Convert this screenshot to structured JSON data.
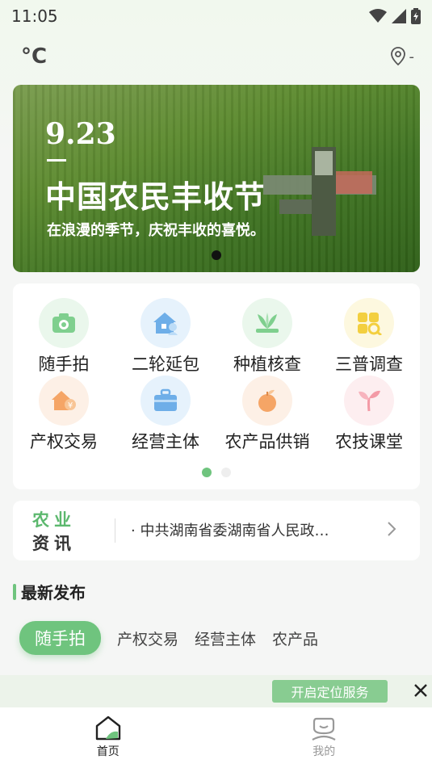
{
  "status": {
    "time": "11:05"
  },
  "header": {
    "temperature": "°C",
    "location": "-"
  },
  "banner": {
    "date": "9.23",
    "title": "中国农民丰收节",
    "subtitle": "在浪漫的季节，庆祝丰收的喜悦。"
  },
  "grid": {
    "items": [
      {
        "label": "随手拍",
        "icon": "camera-icon",
        "color": "#eaf7ec"
      },
      {
        "label": "二轮延包",
        "icon": "house-user-icon",
        "color": "#e6f2fc"
      },
      {
        "label": "种植核查",
        "icon": "plant-icon",
        "color": "#eaf7ec"
      },
      {
        "label": "三普调查",
        "icon": "survey-icon",
        "color": "#fdf8df"
      },
      {
        "label": "产权交易",
        "icon": "house-coin-icon",
        "color": "#fdf0e6"
      },
      {
        "label": "经营主体",
        "icon": "briefcase-icon",
        "color": "#e6f2fc"
      },
      {
        "label": "农产品供销",
        "icon": "fruit-icon",
        "color": "#fdf0e6"
      },
      {
        "label": "农技课堂",
        "icon": "sprout-icon",
        "color": "#fdeef0"
      }
    ]
  },
  "news": {
    "logo_line1": "农业",
    "logo_line2": "资讯",
    "headline": "· 中共湖南省委湖南省人民政…"
  },
  "latest": {
    "title": "最新发布",
    "tabs": [
      "随手拍",
      "产权交易",
      "经营主体",
      "农产品"
    ]
  },
  "location_prompt": {
    "button": "开启定位服务"
  },
  "nav": {
    "home": "首页",
    "mine": "我的"
  },
  "colors": {
    "accent": "#6fc47e"
  }
}
